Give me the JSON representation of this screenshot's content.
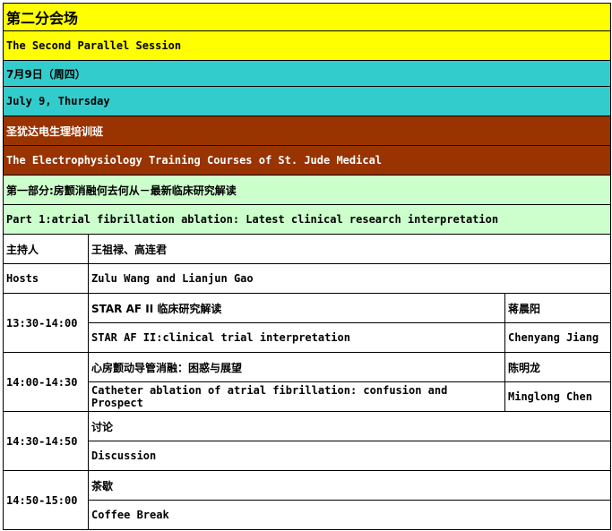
{
  "venue": {
    "title_cn": "第二分会场",
    "title_en": "The Second Parallel Session"
  },
  "date": {
    "cn": "7月9日（周四）",
    "en": "July 9, Thursday"
  },
  "course": {
    "cn": "圣犹达电生理培训班",
    "en": "The Electrophysiology Training Courses of   St. Jude Medical"
  },
  "part": {
    "cn": "第一部分:房颤消融何去何从－最新临床研究解读",
    "en": "Part 1:atrial fibrillation ablation: Latest clinical research interpretation"
  },
  "hosts": {
    "label_cn": "主持人",
    "names_cn": "王祖禄、高连君",
    "label_en": "Hosts",
    "names_en": "Zulu Wang and Lianjun Gao"
  },
  "sessions": [
    {
      "time": "13:30-14:00",
      "topic_cn": "STAR AF II 临床研究解读",
      "topic_en": "STAR AF II:clinical trial interpretation",
      "speaker_cn": "蒋晨阳",
      "speaker_en": "Chenyang Jiang"
    },
    {
      "time": "14:00-14:30",
      "topic_cn": "心房颤动导管消融：困惑与展望",
      "topic_en": "Catheter ablation of atrial fibrillation: confusion and Prospect",
      "speaker_cn": "陈明龙",
      "speaker_en": "Minglong Chen"
    },
    {
      "time": "14:30-14:50",
      "topic_cn": "讨论",
      "topic_en": "Discussion"
    },
    {
      "time": "14:50-15:00",
      "topic_cn": "茶歇",
      "topic_en": "Coffee Break"
    }
  ],
  "colors": {
    "yellow": "#ffff00",
    "cyan": "#33cccc",
    "brown": "#993300",
    "green": "#ccffcc"
  }
}
